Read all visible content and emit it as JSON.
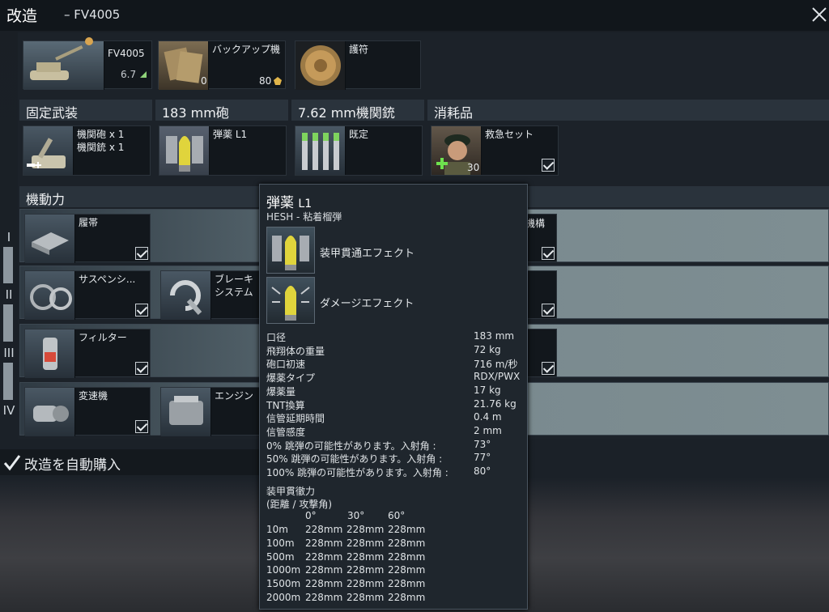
{
  "window": {
    "title": "改造",
    "vehicle": "– FV4005"
  },
  "top_slots": {
    "vehicle": {
      "name": "FV4005",
      "br": "6.7"
    },
    "backup": {
      "label": "バックアップ機",
      "count": "0",
      "price": "80"
    },
    "talisman": {
      "label": "護符"
    }
  },
  "categories": {
    "fixed": "固定武装",
    "gun": "183 mm砲",
    "mg": "7.62 mm機関銃",
    "consumables": "消耗品",
    "mobility": "機動力"
  },
  "weapon_slots": {
    "fixed_line1": "機関砲 x 1",
    "fixed_line2": "機関銃 x 1",
    "shell": "弾薬 L1",
    "mg_default": "既定",
    "medkit": "救急セット",
    "medkit_count": "30"
  },
  "tiers": [
    "I",
    "II",
    "III",
    "IV"
  ],
  "mods": {
    "tracks": "履帯",
    "suspension": "サスペンシ...",
    "brakes": "ブレーキシステム",
    "filter": "フィルター",
    "transmission": "変速機",
    "engine": "エンジン",
    "partial_right": "機構"
  },
  "auto_buy": "改造を自動購入",
  "tooltip": {
    "title": "弾薬",
    "title_suffix": "L1",
    "subtitle": "HESH - 粘着榴弾",
    "effects": [
      "装甲貫通エフェクト",
      "ダメージエフェクト"
    ],
    "stats": [
      {
        "k": "口径",
        "v": "183 mm"
      },
      {
        "k": "飛翔体の重量",
        "v": "72 kg"
      },
      {
        "k": "砲口初速",
        "v": "716 m/秒"
      },
      {
        "k": "爆薬タイプ",
        "v": "RDX/PWX"
      },
      {
        "k": "爆薬量",
        "v": "17 kg"
      },
      {
        "k": "TNT換算",
        "v": "21.76 kg"
      },
      {
        "k": "信管延期時間",
        "v": "0.4 m"
      },
      {
        "k": "信管感度",
        "v": "2 mm"
      },
      {
        "k": "0% 跳弾の可能性があります。入射角 :",
        "v": "73°"
      },
      {
        "k": "50% 跳弾の可能性があります。入射角 :",
        "v": "77°"
      },
      {
        "k": "100% 跳弾の可能性があります。入射角 :",
        "v": "80°"
      }
    ],
    "pen_title": "装甲貫徹力",
    "pen_sub": "(距離 / 攻撃角)",
    "angles": [
      "0°",
      "30°",
      "60°"
    ],
    "pen_rows": [
      {
        "d": "10m",
        "v": [
          "228mm",
          "228mm",
          "228mm"
        ]
      },
      {
        "d": "100m",
        "v": [
          "228mm",
          "228mm",
          "228mm"
        ]
      },
      {
        "d": "500m",
        "v": [
          "228mm",
          "228mm",
          "228mm"
        ]
      },
      {
        "d": "1000m",
        "v": [
          "228mm",
          "228mm",
          "228mm"
        ]
      },
      {
        "d": "1500m",
        "v": [
          "228mm",
          "228mm",
          "228mm"
        ]
      },
      {
        "d": "2000m",
        "v": [
          "228mm",
          "228mm",
          "228mm"
        ]
      }
    ]
  }
}
